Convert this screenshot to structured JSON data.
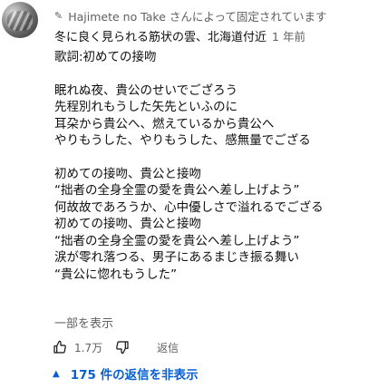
{
  "comment": {
    "pinned_label": "Hajimete no Take さんによって固定されています",
    "author": "冬に良く見られる筋状の雲、北海道付近",
    "timestamp": "1 年前",
    "lines": [
      "歌詞:初めての接吻",
      "",
      "眠れぬ夜、貴公のせいでござろう",
      "先程別れもうした矢先といふのに",
      "耳朶から貴公へ、燃えているから貴公へ",
      "やりもうした、やりもうした、感無量でござる",
      "",
      "初めての接吻、貴公と接吻",
      "“拙者の全身全霊の愛を貴公へ差し上げよう”",
      "何故故であろうか、心中優しさで溢れるでござる",
      "初めての接吻、貴公と接吻",
      "“拙者の全身全霊の愛を貴公へ差し上げよう”",
      "涙が零れ落つる、男子にあるまじき振る舞い",
      "“貴公に惚れもうした”"
    ],
    "read_more": "一部を表示",
    "like_count": "1.7万",
    "reply_label": "返信",
    "replies_toggle": "175 件の返信を非表示"
  },
  "colors": {
    "link": "#065fd4",
    "secondary_text": "#606060",
    "primary_text": "#0f0f0f"
  },
  "icons": {
    "pin": "pin-icon",
    "like": "thumbs-up-icon",
    "dislike": "thumbs-down-icon",
    "caret": "caret-up-icon"
  }
}
